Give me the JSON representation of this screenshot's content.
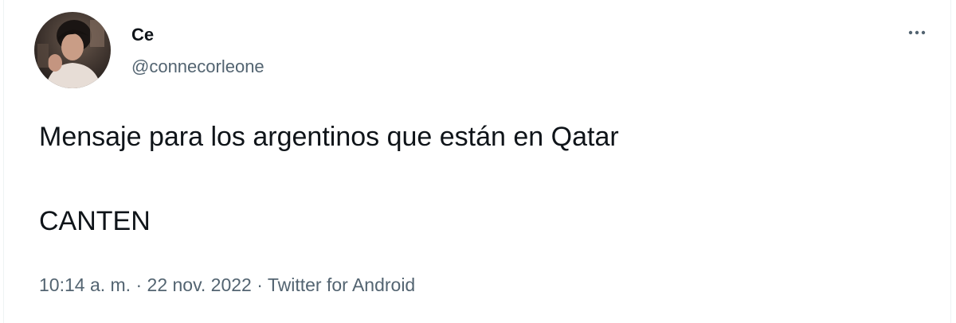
{
  "author": {
    "display_name": "Ce",
    "handle": "@connecorleone",
    "avatar_icon": "profile-photo"
  },
  "menu": {
    "more_icon": "more-horizontal-icon"
  },
  "tweet": {
    "paragraphs": [
      "Mensaje para los argentinos que están en Qatar",
      "CANTEN"
    ]
  },
  "meta": {
    "time": "10:14 a. m.",
    "separator": "·",
    "date": "22 nov. 2022",
    "source": "Twitter for Android"
  },
  "colors": {
    "text_primary": "#0f1419",
    "text_secondary": "#536471",
    "border": "#eff3f4",
    "background": "#ffffff"
  }
}
